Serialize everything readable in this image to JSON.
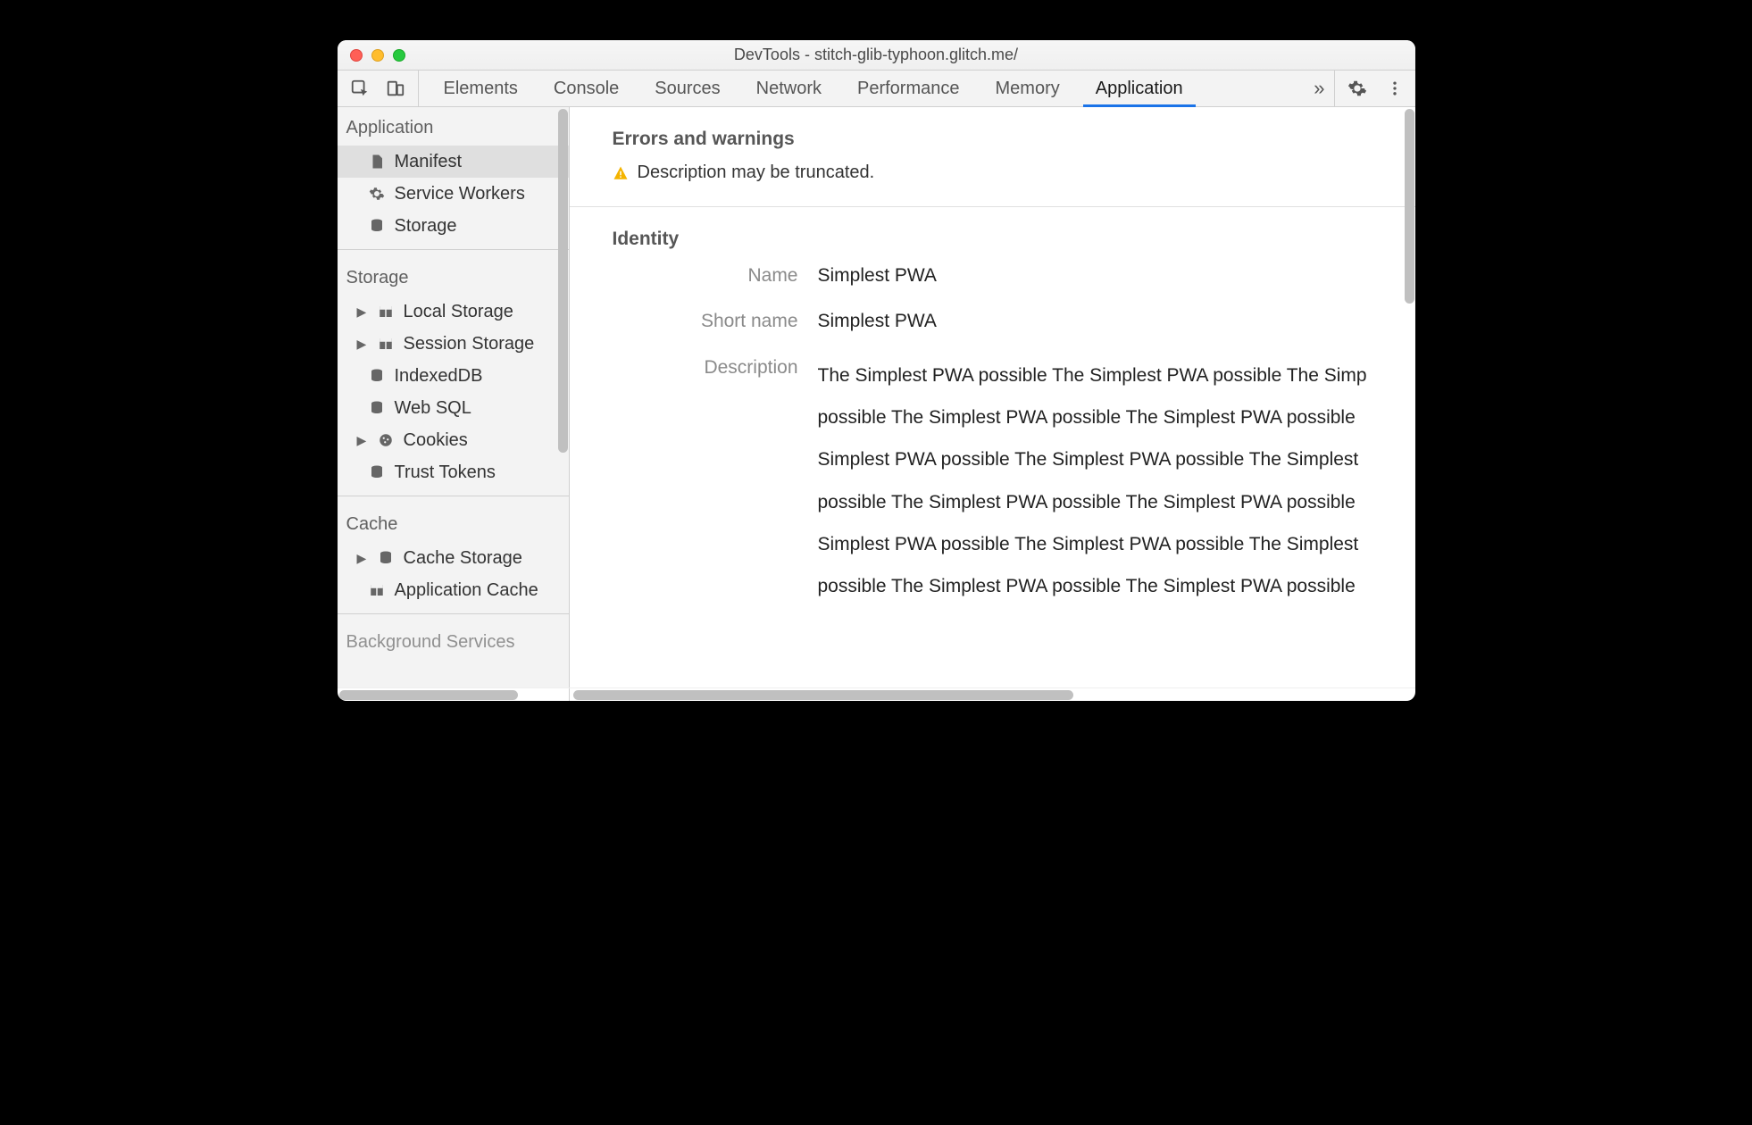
{
  "window": {
    "title": "DevTools - stitch-glib-typhoon.glitch.me/"
  },
  "tabs": {
    "items": [
      "Elements",
      "Console",
      "Sources",
      "Network",
      "Performance",
      "Memory",
      "Application"
    ],
    "active_index": 6
  },
  "sidebar": {
    "groups": [
      {
        "title": "Application",
        "items": [
          {
            "icon": "file-icon",
            "label": "Manifest",
            "selected": true
          },
          {
            "icon": "gear-icon",
            "label": "Service Workers"
          },
          {
            "icon": "database-icon",
            "label": "Storage"
          }
        ]
      },
      {
        "title": "Storage",
        "items": [
          {
            "arrow": true,
            "icon": "table-icon",
            "label": "Local Storage"
          },
          {
            "arrow": true,
            "icon": "table-icon",
            "label": "Session Storage"
          },
          {
            "icon": "database-icon",
            "label": "IndexedDB"
          },
          {
            "icon": "database-icon",
            "label": "Web SQL"
          },
          {
            "arrow": true,
            "icon": "cookie-icon",
            "label": "Cookies"
          },
          {
            "icon": "database-icon",
            "label": "Trust Tokens"
          }
        ]
      },
      {
        "title": "Cache",
        "items": [
          {
            "arrow": true,
            "icon": "database-icon",
            "label": "Cache Storage"
          },
          {
            "icon": "table-icon",
            "label": "Application Cache"
          }
        ]
      },
      {
        "title": "Background Services",
        "items": []
      }
    ]
  },
  "main": {
    "errors_heading": "Errors and warnings",
    "warning_text": "Description may be truncated.",
    "identity_heading": "Identity",
    "fields": {
      "name": {
        "label": "Name",
        "value": "Simplest PWA"
      },
      "short_name": {
        "label": "Short name",
        "value": "Simplest PWA"
      },
      "description": {
        "label": "Description",
        "value": "The Simplest PWA possible The Simplest PWA possible The Simp\npossible The Simplest PWA possible The Simplest PWA possible  \nSimplest PWA possible The Simplest PWA possible The Simplest\npossible The Simplest PWA possible The Simplest PWA possible  \nSimplest PWA possible The Simplest PWA possible The Simplest\npossible The Simplest PWA possible The Simplest PWA possible"
      }
    }
  }
}
